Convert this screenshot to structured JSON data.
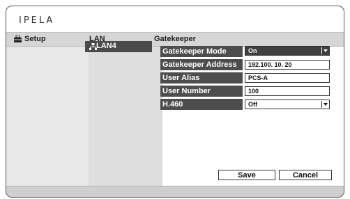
{
  "app": {
    "logo": "IPELA"
  },
  "header": {
    "setup_label": "Setup",
    "lan_label": "LAN",
    "section_label": "Gatekeeper"
  },
  "nav": {
    "selected_item": "LAN4"
  },
  "form": {
    "gatekeeper_mode": {
      "label": "Gatekeeper Mode",
      "value": "On"
    },
    "gatekeeper_address": {
      "label": "Gatekeeper Address",
      "value": "192.100. 10. 20"
    },
    "user_alias": {
      "label": "User Alias",
      "value": "PCS-A"
    },
    "user_number": {
      "label": "User Number",
      "value": "100"
    },
    "h460": {
      "label": "H.460",
      "value": "Off"
    }
  },
  "buttons": {
    "save": "Save",
    "cancel": "Cancel"
  },
  "icons": {
    "setup": "toolbox-icon",
    "lan": "network-icon",
    "dropdown": "chevron-down-icon"
  }
}
